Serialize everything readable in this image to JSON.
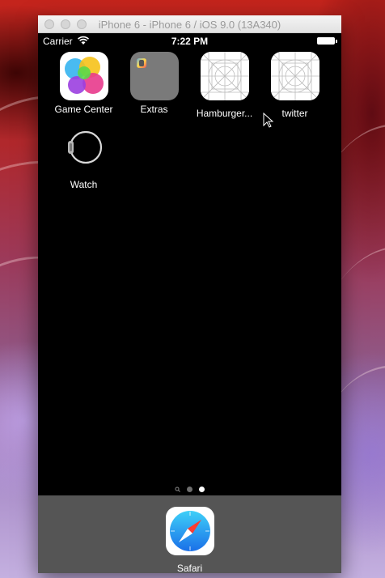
{
  "window": {
    "title": "iPhone 6 - iPhone 6 / iOS 9.0 (13A340)"
  },
  "status_bar": {
    "carrier": "Carrier",
    "time": "7:22 PM"
  },
  "home_apps": [
    {
      "label": "Game Center",
      "icon": "game-center-icon"
    },
    {
      "label": "Extras",
      "icon": "folder-icon"
    },
    {
      "label": "Hamburger...",
      "icon": "blank-app-icon"
    },
    {
      "label": "twitter",
      "icon": "blank-app-icon"
    },
    {
      "label": "Watch",
      "icon": "watch-icon"
    }
  ],
  "page_indicator": {
    "pages": [
      "spotlight",
      "page",
      "page"
    ],
    "current_page": 3
  },
  "dock": {
    "apps": [
      {
        "label": "Safari",
        "icon": "safari-icon"
      }
    ]
  },
  "colors": {
    "screen_bg": "#000000",
    "dock_bg": "#555555",
    "active_dot": "#ffffff",
    "inactive_dot": "#6e6e6e"
  }
}
